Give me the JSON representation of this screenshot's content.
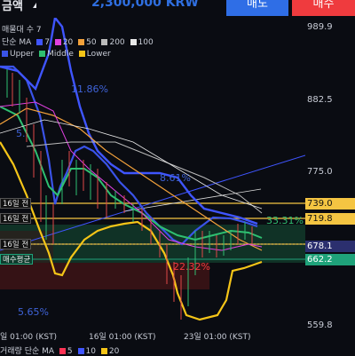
{
  "topbar": {
    "amount_label": "금액",
    "amount_value": "2,300,000 KRW",
    "sell_label": "매도",
    "buy_label": "매수"
  },
  "legend": {
    "count_label": "매물대 수 7",
    "ma_label": "단순 MA",
    "ma_periods": [
      "7",
      "20",
      "50",
      "200",
      "100"
    ],
    "ma_colors": [
      "#3f55ff",
      "#e040e0",
      "#f2a13b",
      "#bbbbbb",
      "#e8e8e8"
    ],
    "bb_upper": "Upper",
    "bb_middle": "Middle",
    "bb_lower": "Lower",
    "bb_colors": [
      "#3a53e8",
      "#2fbf71",
      "#f5c518"
    ]
  },
  "price_axis": {
    "labels": [
      "989.9",
      "882.5",
      "775.0",
      "667.6",
      "559.8"
    ],
    "tags": [
      {
        "text": "739.0",
        "color": "#f5c542"
      },
      {
        "text": "719.8",
        "color": "#f5c542"
      },
      {
        "text": "678.1",
        "color": "#2b2f6e",
        "text_color": "#ffffff"
      },
      {
        "text": "662.2",
        "color": "#1fa27a",
        "text_color": "#ffffff"
      }
    ]
  },
  "chart_labels": {
    "tag_16_a": "16일 전",
    "tag_16_b": "16일 전",
    "tag_16_c": "16일 전",
    "tag_avg": "매수평균",
    "pct_1": "11.86%",
    "pct_2": "5.",
    "pct_3": "8.61%",
    "pct_4": "33.31%",
    "pct_5": "22.32%",
    "pct_6": "5.65%"
  },
  "time_axis": {
    "labels": [
      "일 01:00 (KST)",
      "16일 01:00 (KST)",
      "23일 01:00 (KST)"
    ]
  },
  "volume_legend": {
    "label": "거래량 단순 MA",
    "periods": [
      "5",
      "10",
      "20"
    ],
    "colors": [
      "#ff3355",
      "#3f55ff",
      "#f5c518"
    ]
  }
}
